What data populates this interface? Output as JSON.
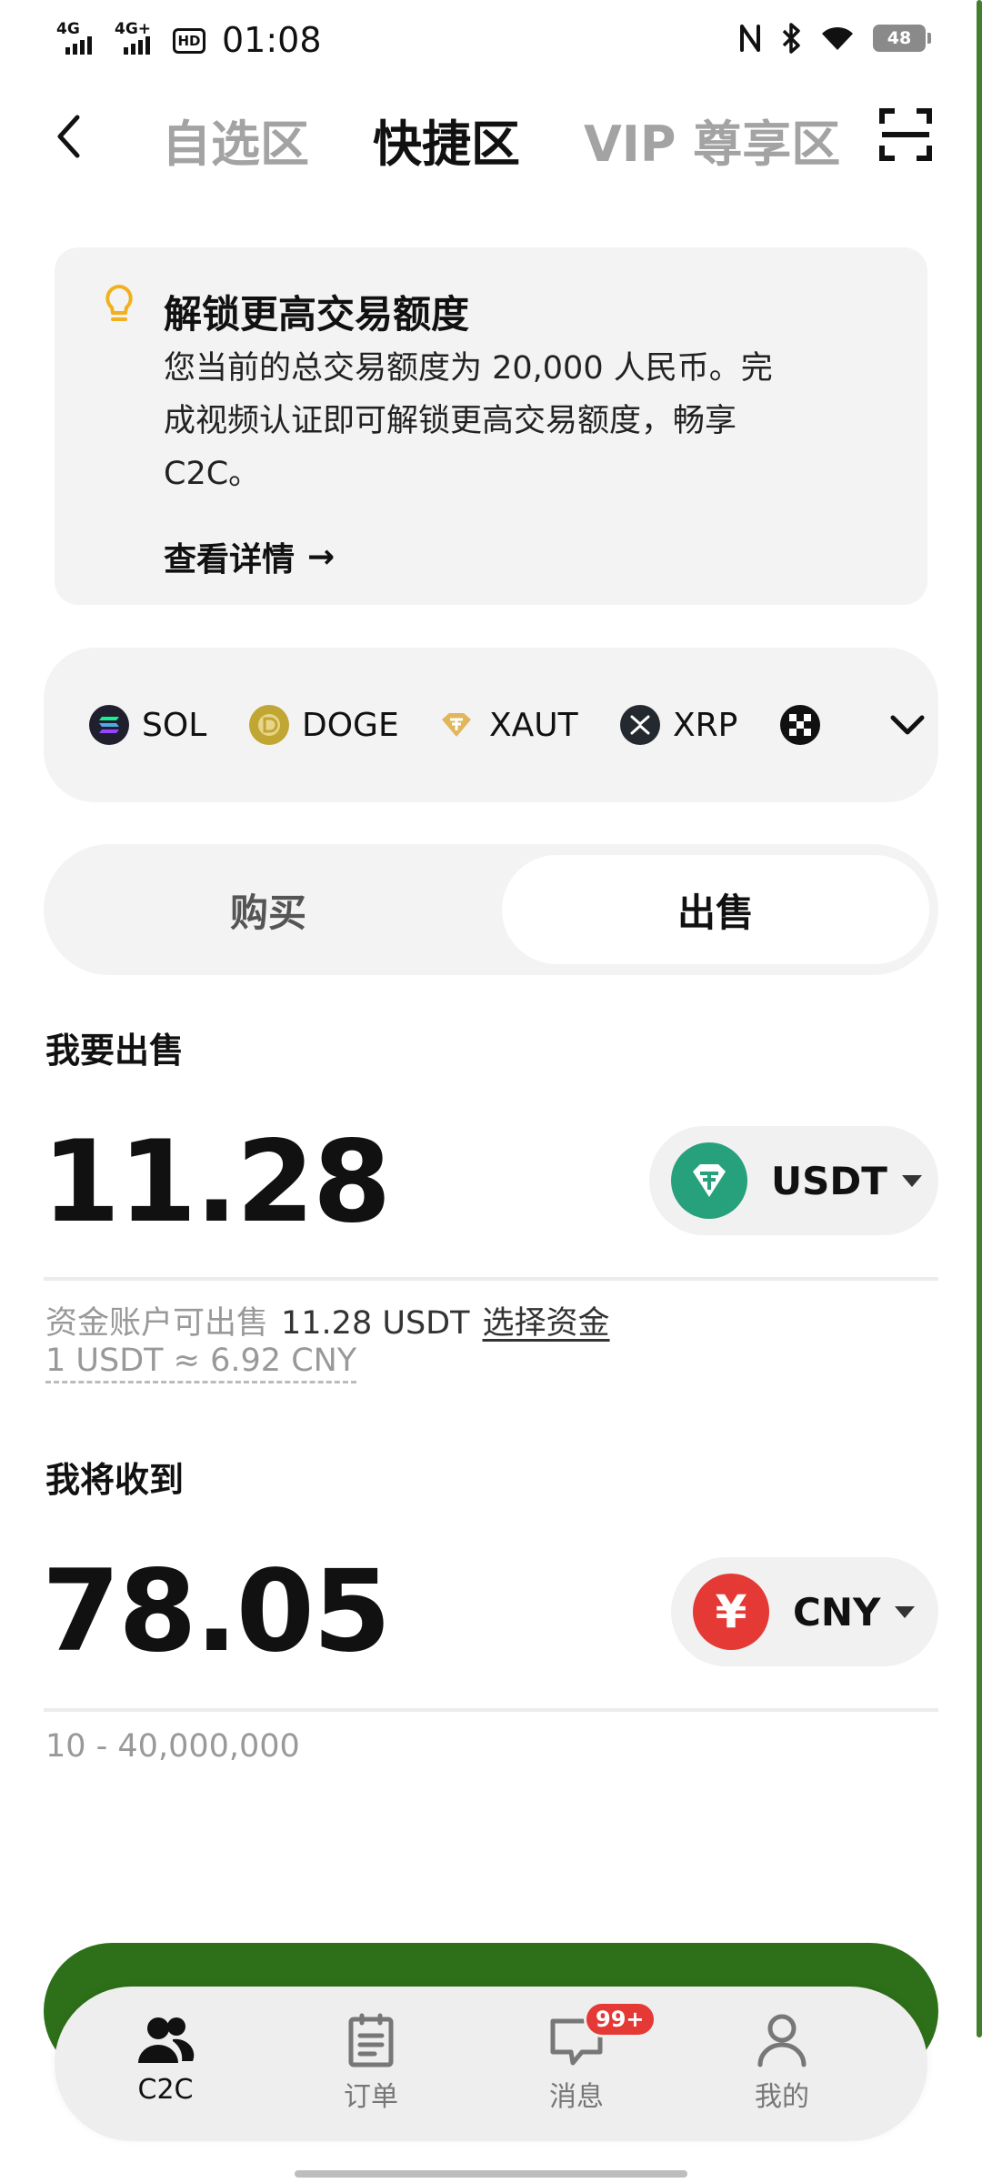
{
  "status_bar": {
    "signal1": "4G",
    "signal2": "4G+",
    "hd": "HD",
    "time": "01:08",
    "battery": "48"
  },
  "nav": {
    "tabs": [
      {
        "label": "自选区"
      },
      {
        "label": "快捷区"
      },
      {
        "label": "VIP 尊享区"
      }
    ],
    "active_tab": "快捷区"
  },
  "notice": {
    "title": "解锁更高交易额度",
    "body": "您当前的总交易额度为 20,000 人民币。完成视频认证即可解锁更高交易额度，畅享 C2C。",
    "link": "查看详情",
    "link_arrow": "→"
  },
  "coins": [
    {
      "name": "SOL",
      "icon": "solana-icon"
    },
    {
      "name": "DOGE",
      "icon": "dogecoin-icon"
    },
    {
      "name": "XAUT",
      "icon": "tether-gold-icon"
    },
    {
      "name": "XRP",
      "icon": "xrp-icon"
    },
    {
      "name": "",
      "icon": "checker-coin-icon"
    }
  ],
  "segment": {
    "buy": "购买",
    "sell": "出售",
    "selected": "出售"
  },
  "sell": {
    "label": "我要出售",
    "amount": "11.28",
    "currency": "USDT",
    "available_label": "资金账户可出售",
    "available_value": "11.28 USDT",
    "select_fund": "选择资金",
    "rate": "1 USDT ≈ 6.92 CNY"
  },
  "receive": {
    "label": "我将收到",
    "amount": "78.05",
    "currency": "CNY",
    "currency_symbol": "¥",
    "range": "10 - 40,000,000"
  },
  "bottom_nav": {
    "items": [
      {
        "label": "C2C",
        "icon": "users-icon"
      },
      {
        "label": "订单",
        "icon": "clipboard-icon"
      },
      {
        "label": "消息",
        "icon": "chat-icon",
        "badge": "99+"
      },
      {
        "label": "我的",
        "icon": "user-icon"
      }
    ],
    "active": "C2C"
  },
  "colors": {
    "accent_green": "#2e7019",
    "tether": "#26a17b",
    "cny_red": "#e53935",
    "card_bg": "#f3f3f3"
  }
}
